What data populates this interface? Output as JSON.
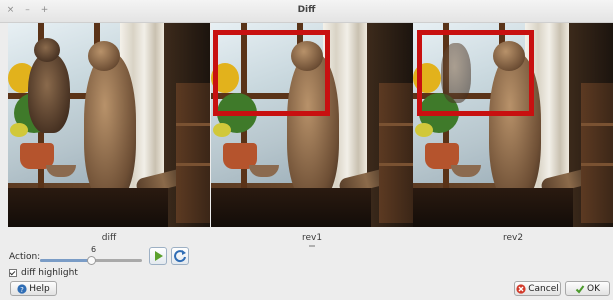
{
  "window": {
    "title": "Diff",
    "controls": [
      "close-icon",
      "minimize-icon",
      "maximize-icon"
    ]
  },
  "panels": [
    {
      "caption": "diff",
      "highlight": false
    },
    {
      "caption": "rev1",
      "highlight": true
    },
    {
      "caption": "rev2",
      "highlight": true
    }
  ],
  "action": {
    "label": "Action:",
    "value": "6",
    "slider_fraction": 0.5
  },
  "toolbar": {
    "play_icon": "play-icon",
    "refresh_icon": "refresh-icon"
  },
  "options": {
    "diff_highlight_label": "diff highlight",
    "diff_highlight_checked": true
  },
  "buttons": {
    "help": "Help",
    "cancel": "Cancel",
    "ok": "OK"
  },
  "colors": {
    "highlight": "#c81010",
    "play": "#5aa02c",
    "refresh": "#2f6db5",
    "cancel_icon": "#d23a2a",
    "ok_icon": "#4b9a2b",
    "help_icon": "#2f6db5"
  }
}
